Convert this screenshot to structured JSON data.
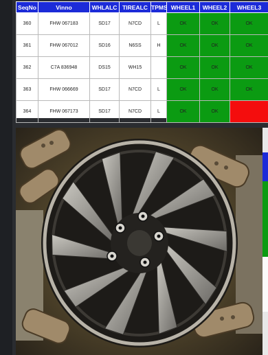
{
  "table": {
    "headers": [
      "SeqNo",
      "Vinno",
      "WHLALC",
      "TIREALC",
      "TPMS",
      "WHEEL1",
      "WHEEL2",
      "WHEEL3"
    ],
    "rows": [
      {
        "seq": "360",
        "vin": "FHW 067183",
        "whlalc": "SD17",
        "tirealc": "N7CD",
        "tpms": "L",
        "w1": "OK",
        "w2": "OK",
        "w3": "OK"
      },
      {
        "seq": "361",
        "vin": "FHW 067012",
        "whlalc": "SD16",
        "tirealc": "N6SS",
        "tpms": "H",
        "w1": "OK",
        "w2": "OK",
        "w3": "OK"
      },
      {
        "seq": "362",
        "vin": "C7A 836948",
        "whlalc": "DS15",
        "tirealc": "WH15",
        "tpms": "",
        "w1": "OK",
        "w2": "OK",
        "w3": "OK"
      },
      {
        "seq": "363",
        "vin": "FHW 066669",
        "whlalc": "SD17",
        "tirealc": "N7CD",
        "tpms": "L",
        "w1": "OK",
        "w2": "OK",
        "w3": "OK"
      },
      {
        "seq": "364",
        "vin": "FHW 067173",
        "whlalc": "SD17",
        "tirealc": "N7CD",
        "tpms": "L",
        "w1": "OK",
        "w2": "OK",
        "w3": ""
      }
    ],
    "status_colors": {
      "ok": "#0b9b12",
      "ng": "#f40d0d",
      "header": "#1c2bd8"
    }
  },
  "camera": {
    "subject": "alloy-wheel-icon"
  }
}
